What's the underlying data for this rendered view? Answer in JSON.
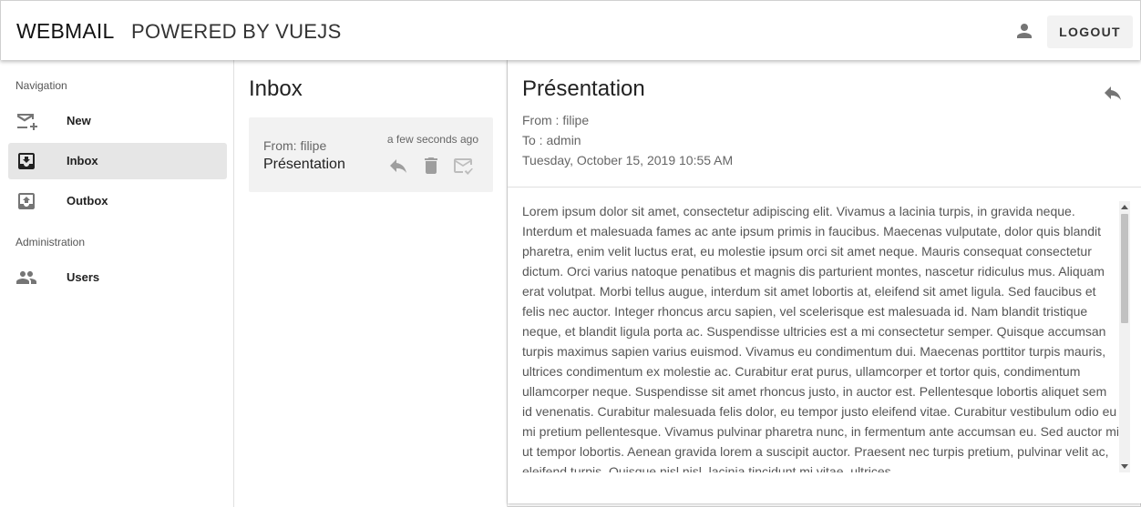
{
  "app": {
    "brand": "WEBMAIL",
    "subtitle": "POWERED BY VUEJS",
    "logout_label": "LOGOUT"
  },
  "sidebar": {
    "nav_section": "Navigation",
    "admin_section": "Administration",
    "items": [
      {
        "label": "New",
        "icon": "new-mail-icon",
        "active": false
      },
      {
        "label": "Inbox",
        "icon": "inbox-icon",
        "active": true
      },
      {
        "label": "Outbox",
        "icon": "outbox-icon",
        "active": false
      },
      {
        "label": "Users",
        "icon": "users-icon",
        "active": false
      }
    ]
  },
  "inbox": {
    "title": "Inbox",
    "messages": [
      {
        "from": "From: filipe",
        "subject": "Présentation",
        "time": "a few seconds ago"
      }
    ]
  },
  "reader": {
    "title": "Présentation",
    "from": "From : filipe",
    "to": "To : admin",
    "date": "Tuesday, October 15, 2019 10:55 AM",
    "body": "Lorem ipsum dolor sit amet, consectetur adipiscing elit. Vivamus a lacinia turpis, in gravida neque. Interdum et malesuada fames ac ante ipsum primis in faucibus. Maecenas vulputate, dolor quis blandit pharetra, enim velit luctus erat, eu molestie ipsum orci sit amet neque. Mauris consequat consectetur dictum. Orci varius natoque penatibus et magnis dis parturient montes, nascetur ridiculus mus. Aliquam erat volutpat. Morbi tellus augue, interdum sit amet lobortis at, eleifend sit amet ligula. Sed faucibus et felis nec auctor. Integer rhoncus arcu sapien, vel scelerisque est malesuada id. Nam blandit tristique neque, et blandit ligula porta ac. Suspendisse ultricies est a mi consectetur semper. Quisque accumsan turpis maximus sapien varius euismod. Vivamus eu condimentum dui. Maecenas porttitor turpis mauris, ultrices condimentum ex molestie ac. Curabitur erat purus, ullamcorper et tortor quis, condimentum ullamcorper neque. Suspendisse sit amet rhoncus justo, in auctor est. Pellentesque lobortis aliquet sem id venenatis. Curabitur malesuada felis dolor, eu tempor justo eleifend vitae. Curabitur vestibulum odio eu mi pretium pellentesque. Vivamus pulvinar pharetra nunc, in fermentum ante accumsan eu. Sed auctor mi ut tempor lobortis. Aenean gravida lorem a suscipit auctor. Praesent nec turpis pretium, pulvinar velit ac, eleifend turpis. Quisque nisl nisl, lacinia tincidunt mi vitae, ultrices"
  },
  "colors": {
    "icon": "#757575",
    "active_bg": "#e6e6e6",
    "card_bg": "#f2f2f2",
    "check_icon": "#bdbdbd"
  }
}
